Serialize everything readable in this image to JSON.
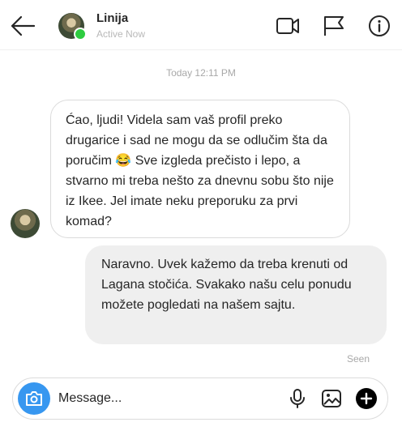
{
  "header": {
    "name": "Linija",
    "status": "Active Now",
    "icons": [
      "back-arrow-icon",
      "video-camera-icon",
      "flag-icon",
      "info-icon"
    ]
  },
  "timestamp": "Today 12:11 PM",
  "messages": [
    {
      "direction": "incoming",
      "text": "Ćao, ljudi! Videla sam vaš profil preko drugarice i sad ne mogu da se odlučim šta da poručim 😂 Sve izgleda prečisto i lepo, a stvarno mi treba nešto za dnevnu sobu što nije iz Ikee. Jel imate neku preporuku za prvi komad?"
    },
    {
      "direction": "outgoing",
      "text": "Naravno. Uvek kažemo da treba krenuti od Lagana stočića. Svakako našu celu ponudu možete pogledati na našem sajtu."
    }
  ],
  "seen_label": "Seen",
  "composer": {
    "placeholder": "Message...",
    "icons": [
      "camera-icon",
      "microphone-icon",
      "image-icon",
      "plus-icon"
    ]
  },
  "colors": {
    "accent": "#3797f0",
    "online": "#2ecc40",
    "outgoing_bubble": "#efefef",
    "muted_text": "#a8a8a8"
  }
}
